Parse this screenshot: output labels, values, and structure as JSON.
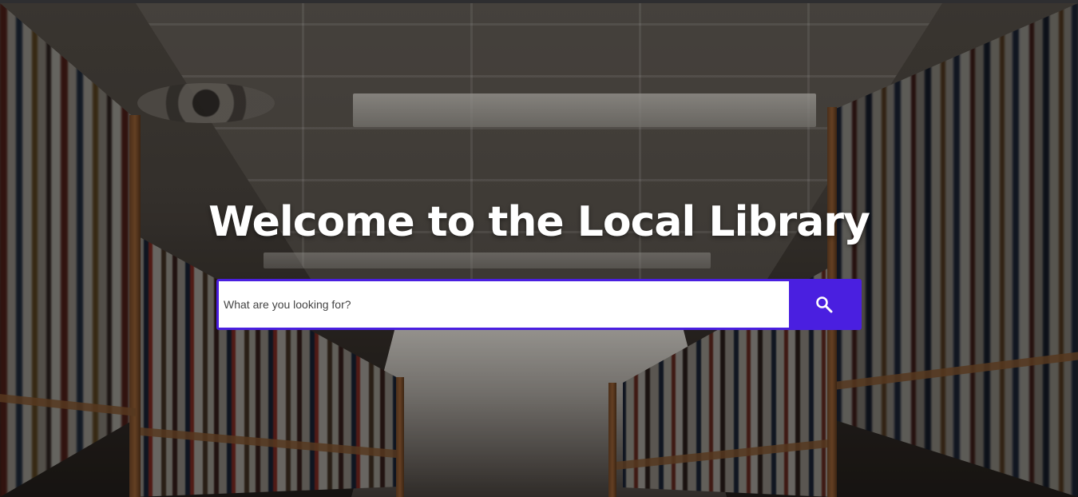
{
  "hero": {
    "title": "Welcome to the Local Library"
  },
  "search": {
    "placeholder": "What are you looking for?",
    "value": "",
    "button_icon": "search-icon"
  },
  "colors": {
    "accent": "#4a1fe0",
    "title_text": "#ffffff",
    "input_background": "#ffffff"
  }
}
